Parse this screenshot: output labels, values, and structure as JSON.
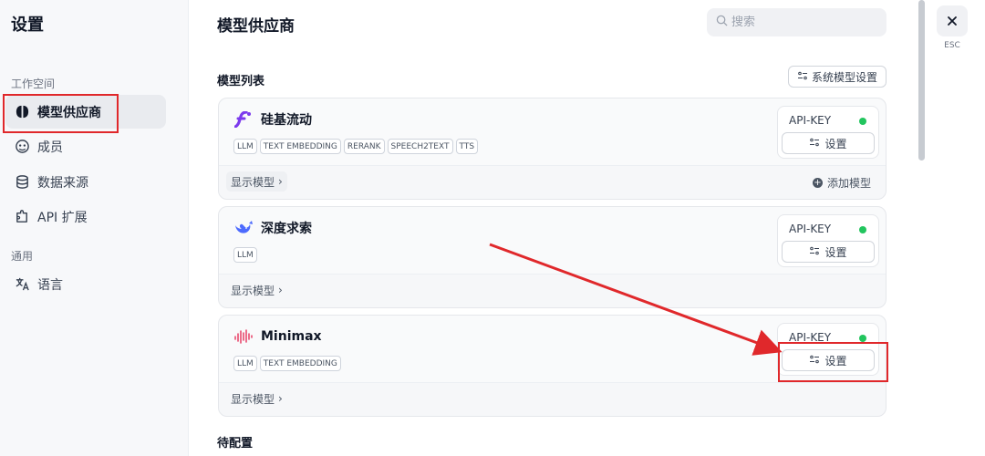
{
  "sidebar": {
    "title": "设置",
    "section_workspace": "工作空间",
    "section_general": "通用",
    "items": [
      {
        "label": "模型供应商",
        "icon": "brain-icon",
        "active": true
      },
      {
        "label": "成员",
        "icon": "members-icon",
        "active": false
      },
      {
        "label": "数据来源",
        "icon": "database-icon",
        "active": false
      },
      {
        "label": "API 扩展",
        "icon": "puzzle-icon",
        "active": false
      },
      {
        "label": "语言",
        "icon": "translate-icon",
        "active": false
      }
    ]
  },
  "main": {
    "title": "模型供应商",
    "search_placeholder": "搜索",
    "list_title": "模型列表",
    "system_model_settings": "系统模型设置",
    "pending_title": "待配置",
    "providers": [
      {
        "name": "硅基流动",
        "logo": "siliconflow-logo",
        "tags": [
          "LLM",
          "TEXT EMBEDDING",
          "RERANK",
          "SPEECH2TEXT",
          "TTS"
        ],
        "show_models": "显示模型",
        "add_model": "添加模型",
        "api_key_label": "API-KEY",
        "settings_label": "设置"
      },
      {
        "name": "深度求索",
        "logo": "deepseek-logo",
        "tags": [
          "LLM"
        ],
        "show_models": "显示模型",
        "api_key_label": "API-KEY",
        "settings_label": "设置"
      },
      {
        "name": "Minimax",
        "logo": "minimax-logo",
        "tags": [
          "LLM",
          "TEXT EMBEDDING"
        ],
        "show_models": "显示模型",
        "api_key_label": "API-KEY",
        "settings_label": "设置"
      }
    ]
  },
  "close": {
    "esc_label": "ESC"
  },
  "colors": {
    "annotation": "#e0282b",
    "status_ok": "#22c55e"
  }
}
